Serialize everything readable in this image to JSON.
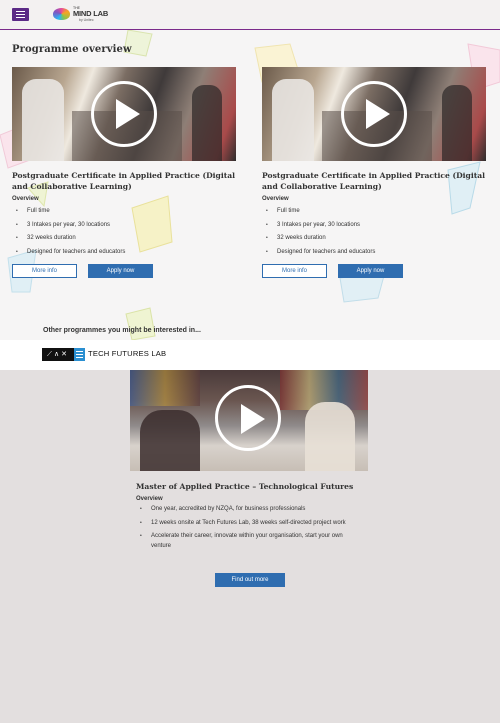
{
  "header": {
    "menu_icon": "hamburger-icon",
    "logo_the": "THE",
    "logo_name": "MIND LAB",
    "logo_by": "by Unitec"
  },
  "programme_overview": {
    "title": "Programme overview",
    "cards": [
      {
        "title": "Postgraduate Certificate in Applied Practice (Digital and Collaborative Learning)",
        "overview_label": "Overview",
        "bullets": [
          "Full time",
          "3 Intakes per year, 30 locations",
          "32 weeks duration",
          "Designed for teachers and educators"
        ],
        "more_info": "More info",
        "apply_now": "Apply now"
      },
      {
        "title": "Postgraduate Certificate in Applied Practice (Digital and Collaborative Learning)",
        "overview_label": "Overview",
        "bullets": [
          "Full time",
          "3 Intakes per year, 30 locations",
          "32 weeks duration",
          "Designed for teachers and educators"
        ],
        "more_info": "More info",
        "apply_now": "Apply now"
      }
    ]
  },
  "other_programmes": {
    "title": "Other programmes you might be interested in...",
    "logo_mark": "⟋∧✕",
    "logo_text": "TECH FUTURES LAB",
    "card": {
      "title": "Master of Applied Practice – Technological Futures",
      "overview_label": "Overview",
      "bullets": [
        "One year, accredited by NZQA, for business professionals",
        "12 weeks onsite at Tech Futures Lab, 38 weeks self-directed project work",
        "Accelerate their career, innovate within your organisation, start your own venture"
      ],
      "find_out_more": "Find out more"
    }
  },
  "colors": {
    "brand_purple": "#5b2a86",
    "button_blue": "#2f6db0",
    "page_bg": "#e3dfdf",
    "tfl_blue": "#2a8fd1"
  }
}
